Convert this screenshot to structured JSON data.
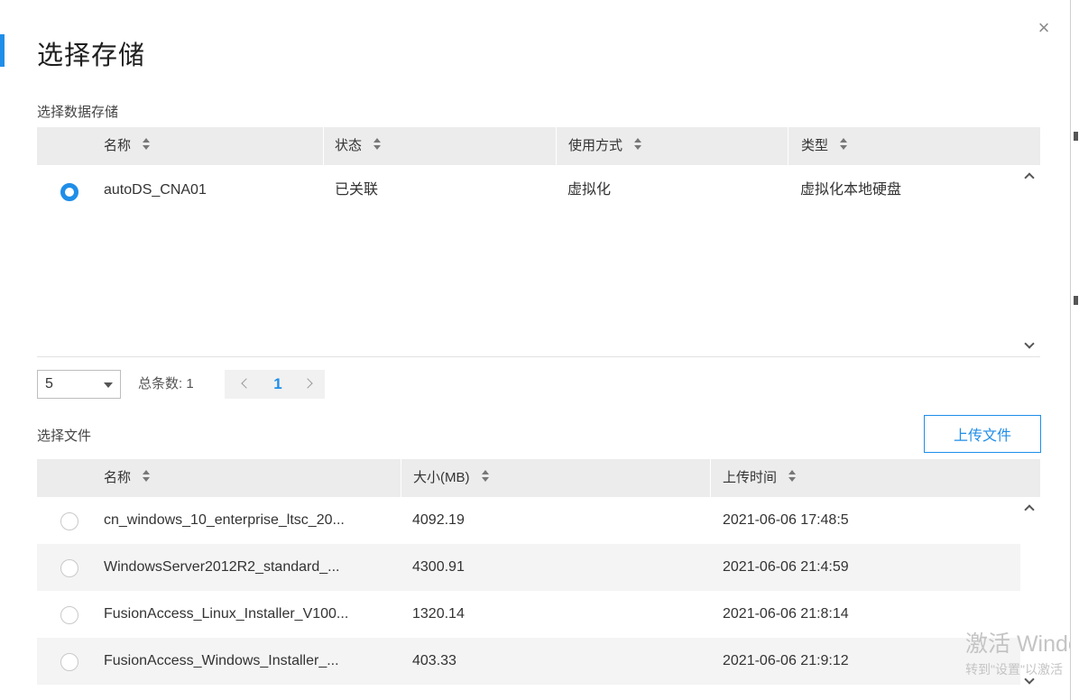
{
  "dialog": {
    "title": "选择存储",
    "close_symbol": "×"
  },
  "datastore": {
    "section_label": "选择数据存储",
    "columns": [
      {
        "label": "名称"
      },
      {
        "label": "状态"
      },
      {
        "label": "使用方式"
      },
      {
        "label": "类型"
      }
    ],
    "rows": [
      {
        "name": "autoDS_CNA01",
        "status": "已关联",
        "usage": "虚拟化",
        "type": "虚拟化本地硬盘",
        "selected": true
      }
    ],
    "pager": {
      "page_size": "5",
      "total_label": "总条数: 1",
      "current_page": "1"
    }
  },
  "files": {
    "section_label": "选择文件",
    "upload_label": "上传文件",
    "columns": [
      {
        "label": "名称"
      },
      {
        "label": "大小(MB)"
      },
      {
        "label": "上传时间"
      }
    ],
    "rows": [
      {
        "name": "cn_windows_10_enterprise_ltsc_20...",
        "size": "4092.19",
        "time": "2021-06-06 17:48:5"
      },
      {
        "name": "WindowsServer2012R2_standard_...",
        "size": "4300.91",
        "time": "2021-06-06 21:4:59"
      },
      {
        "name": "FusionAccess_Linux_Installer_V100...",
        "size": "1320.14",
        "time": "2021-06-06 21:8:14"
      },
      {
        "name": "FusionAccess_Windows_Installer_...",
        "size": "403.33",
        "time": "2021-06-06 21:9:12"
      }
    ]
  },
  "watermark": {
    "line1": "激活 Windows",
    "line2": "转到\"设置\"以激活"
  },
  "colors": {
    "accent": "#1f8ee8",
    "header_bg": "#ececec",
    "alt_row_bg": "#f4f4f4"
  }
}
